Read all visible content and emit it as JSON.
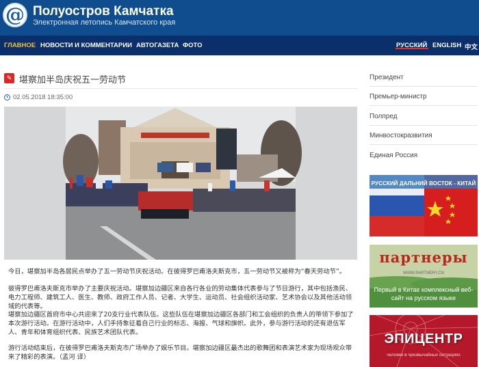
{
  "header": {
    "logo_glyph": "@",
    "title": "Полуостров Камчатка",
    "subtitle": "Электронная летопись Камчатского края",
    "bg_color": "#0f4d8f"
  },
  "nav": {
    "items": [
      "ГЛАВНОЕ",
      "НОВОСТИ И КОММЕНТАРИИ",
      "АВТОГАЗЕТА",
      "ФОТО"
    ],
    "active_index": 0,
    "languages": [
      "РУССКИЙ",
      "ENGLISH",
      "中文"
    ],
    "active_language_index": 0,
    "active_color": "#f3c33b"
  },
  "article": {
    "title": "堪察加半岛庆祝五一劳动节",
    "date": "02.05.2018 18:35:00",
    "paragraphs": [
      "今日，堪察加半岛各居民点举办了五一劳动节庆祝活动。在彼得罗巴甫洛夫斯克市，五一劳动节又被称为“春天劳动节”。",
      "彼得罗巴甫洛夫斯克市举办了主要庆祝活动。堪察加边疆区来自各行各业的劳动集体代表参与了节日游行，其中包括渔民、电力工程师、建筑工人、医生、教师、政府工作人员、记者、大学生、运动员、社会组织活动家、艺术协会以及其他活动领域的代表等。",
      "堪察加边疆区首府市中心共迎来了20支行业代表队伍。这些队伍在堪察加边疆区各部门和工会组织的负责人的带领下参加了本次游行活动。在游行活动中，人们手持象征着自己行业的标志、海报、气球和旗帜。此外，参与游行活动的还有退伍军人、青年和体育组织代表、民族艺术团队代表。",
      "游行活动结束后，在彼得罗巴甫洛夫斯克市广场举办了娱乐节目。堪察加边疆区最杰出的歌舞团和表演艺术家为现场观众带来了精彩的表演。（孟河 译）"
    ]
  },
  "sidebar": {
    "links": [
      "Президент",
      "Премьер-министр",
      "Полпред",
      "Минвостокразвития",
      "Единая Россия"
    ],
    "banners": {
      "china": {
        "caption": "РУССКИЙ ДАЛЬНИЙ ВОСТОК - КИТАЙ"
      },
      "partners": {
        "title": "партнеры",
        "url": "WWW.PARTNERY.CN",
        "caption": "Первый в Китае комплексный веб-сайт на русском языке"
      },
      "epicenter": {
        "title": "ЭПИЦЕНТР",
        "caption": "человек в чрезвычайных ситуациях"
      }
    }
  }
}
